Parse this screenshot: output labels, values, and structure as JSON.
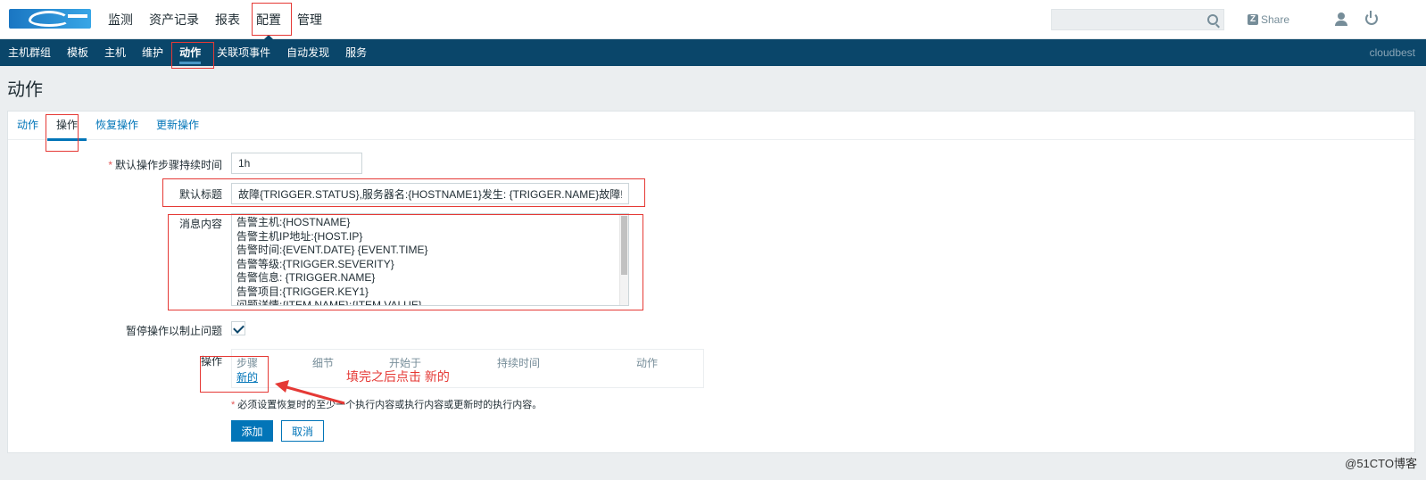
{
  "mainmenu": {
    "items": [
      {
        "label": "监测"
      },
      {
        "label": "资产记录"
      },
      {
        "label": "报表"
      },
      {
        "label": "配置"
      },
      {
        "label": "管理"
      }
    ]
  },
  "header_right": {
    "search_placeholder": "",
    "share_label": "Share",
    "share_icon_glyph": "Z"
  },
  "submenu": {
    "items": [
      {
        "label": "主机群组"
      },
      {
        "label": "模板"
      },
      {
        "label": "主机"
      },
      {
        "label": "维护"
      },
      {
        "label": "动作"
      },
      {
        "label": "关联项事件"
      },
      {
        "label": "自动发现"
      },
      {
        "label": "服务"
      }
    ],
    "server_name": "cloudbest"
  },
  "page": {
    "title": "动作"
  },
  "tabs": [
    {
      "label": "动作"
    },
    {
      "label": "操作"
    },
    {
      "label": "恢复操作"
    },
    {
      "label": "更新操作"
    }
  ],
  "form": {
    "step_duration": {
      "label": "默认操作步骤持续时间",
      "value": "1h"
    },
    "default_subject": {
      "label": "默认标题",
      "value": "故障{TRIGGER.STATUS},服务器名:{HOSTNAME1}发生: {TRIGGER.NAME}故障!"
    },
    "message": {
      "label": "消息内容",
      "lines": [
        "告警主机:{HOSTNAME}",
        "告警主机IP地址:{HOST.IP}",
        "告警时间:{EVENT.DATE} {EVENT.TIME}",
        "告警等级:{TRIGGER.SEVERITY}",
        "告警信息: {TRIGGER.NAME}",
        "告警项目:{TRIGGER.KEY1}",
        "问题详情:{ITEM.NAME}:{ITEM.VALUE}"
      ]
    },
    "pause": {
      "label": "暂停操作以制止问题",
      "checked": true
    },
    "operations": {
      "label": "操作",
      "columns": [
        "步骤",
        "细节",
        "开始于",
        "持续时间",
        "动作"
      ],
      "new_link": "新的"
    },
    "note": "必须设置恢复时的至少一个执行内容或执行内容或更新时的执行内容。",
    "add_button": "添加",
    "cancel_button": "取消"
  },
  "annotation": {
    "text": "填完之后点击  新的",
    "color": "#e53935"
  },
  "watermark": "@51CTO博客"
}
